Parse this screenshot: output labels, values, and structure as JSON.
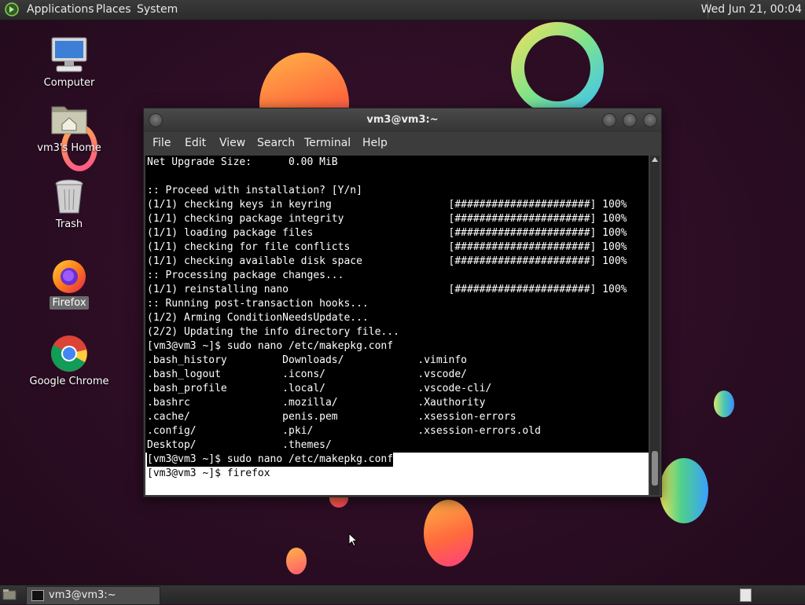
{
  "top_panel": {
    "menus": [
      "Applications",
      "Places",
      "System"
    ],
    "clock": "Wed Jun 21, 00:04"
  },
  "desktop_icons": [
    {
      "label": "Computer",
      "icon": "computer-icon"
    },
    {
      "label": "vm3's Home",
      "icon": "home-folder-icon"
    },
    {
      "label": "Trash",
      "icon": "trash-icon"
    },
    {
      "label": "Firefox",
      "icon": "firefox-icon"
    },
    {
      "label": "Google Chrome",
      "icon": "chrome-icon"
    }
  ],
  "terminal": {
    "title": "vm3@vm3:~",
    "menu": [
      "File",
      "Edit",
      "View",
      "Search",
      "Terminal",
      "Help"
    ],
    "lines": [
      "Net Upgrade Size:      0.00 MiB",
      "",
      ":: Proceed with installation? [Y/n]",
      "(1/1) checking keys in keyring                   [######################] 100%",
      "(1/1) checking package integrity                 [######################] 100%",
      "(1/1) loading package files                      [######################] 100%",
      "(1/1) checking for file conflicts                [######################] 100%",
      "(1/1) checking available disk space              [######################] 100%",
      ":: Processing package changes...",
      "(1/1) reinstalling nano                          [######################] 100%",
      ":: Running post-transaction hooks...",
      "(1/2) Arming ConditionNeedsUpdate...",
      "(2/2) Updating the info directory file...",
      "[vm3@vm3 ~]$ sudo nano /etc/makepkg.conf",
      ".bash_history         Downloads/            .viminfo",
      ".bash_logout          .icons/               .vscode/",
      ".bash_profile         .local/               .vscode-cli/",
      ".bashrc               .mozilla/             .Xauthority",
      ".cache/               penis.pem             .xsession-errors",
      ".config/              .pki/                 .xsession-errors.old",
      "Desktop/              .themes/",
      "[vm3@vm3 ~]$ sudo nano /etc/makepkg.conf",
      "[vm3@vm3 ~]$ firefox"
    ]
  },
  "taskbar": {
    "task_label": "vm3@vm3:~"
  },
  "colors": {
    "desktop_bg": "#2c0d24",
    "terminal_bg": "#000000",
    "terminal_fg": "#ffffff",
    "panel_bg": "#2f2f2f"
  }
}
